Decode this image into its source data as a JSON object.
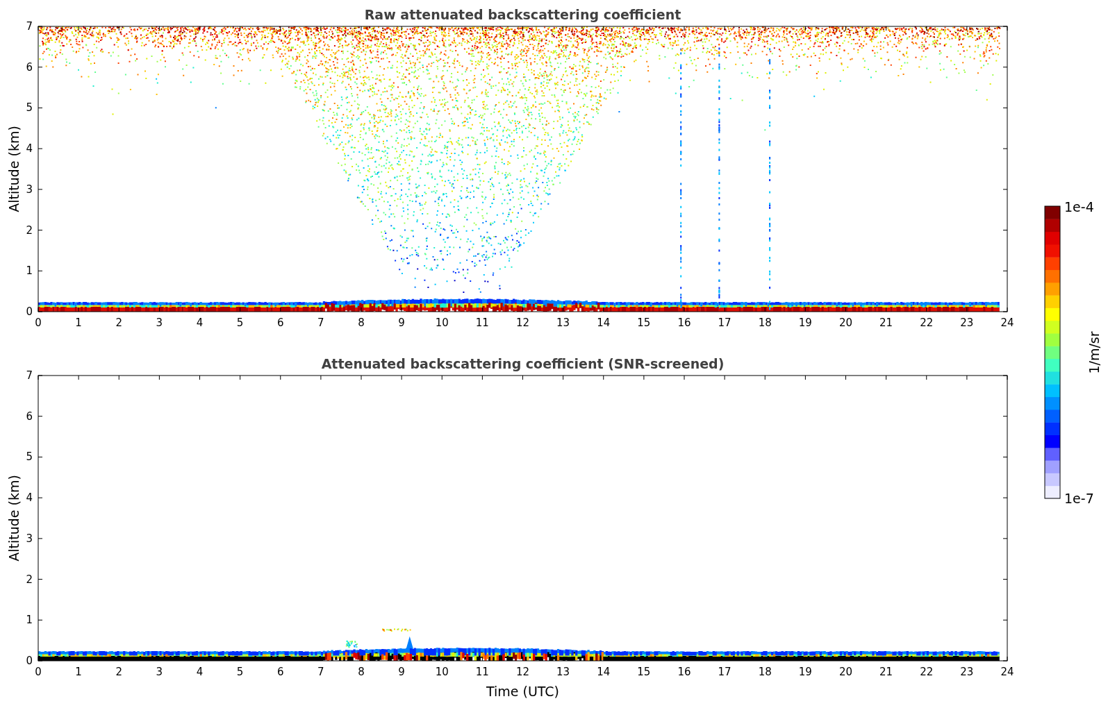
{
  "panels": [
    {
      "kind": "raw",
      "title": "Raw attenuated backscattering coefficient",
      "ylabel": "Altitude (km)",
      "xticks": [
        "0",
        "1",
        "2",
        "3",
        "4",
        "5",
        "6",
        "7",
        "8",
        "9",
        "10",
        "11",
        "12",
        "13",
        "14",
        "15",
        "16",
        "17",
        "18",
        "19",
        "20",
        "21",
        "22",
        "23",
        "24"
      ],
      "yticks": [
        "7",
        "6",
        "5",
        "4",
        "3",
        "2",
        "1",
        "0"
      ]
    },
    {
      "kind": "screened",
      "title": "Attenuated backscattering coefficient (SNR-screened)",
      "ylabel": "Altitude (km)",
      "xlabel": "Time (UTC)",
      "xticks": [
        "0",
        "1",
        "2",
        "3",
        "4",
        "5",
        "6",
        "7",
        "8",
        "9",
        "10",
        "11",
        "12",
        "13",
        "14",
        "15",
        "16",
        "17",
        "18",
        "19",
        "20",
        "21",
        "22",
        "23",
        "24"
      ],
      "yticks": [
        "7",
        "6",
        "5",
        "4",
        "3",
        "2",
        "1",
        "0"
      ]
    }
  ],
  "colorbar": {
    "max_label": "1e-4",
    "min_label": "1e-7",
    "label": "1/m/sr"
  }
}
